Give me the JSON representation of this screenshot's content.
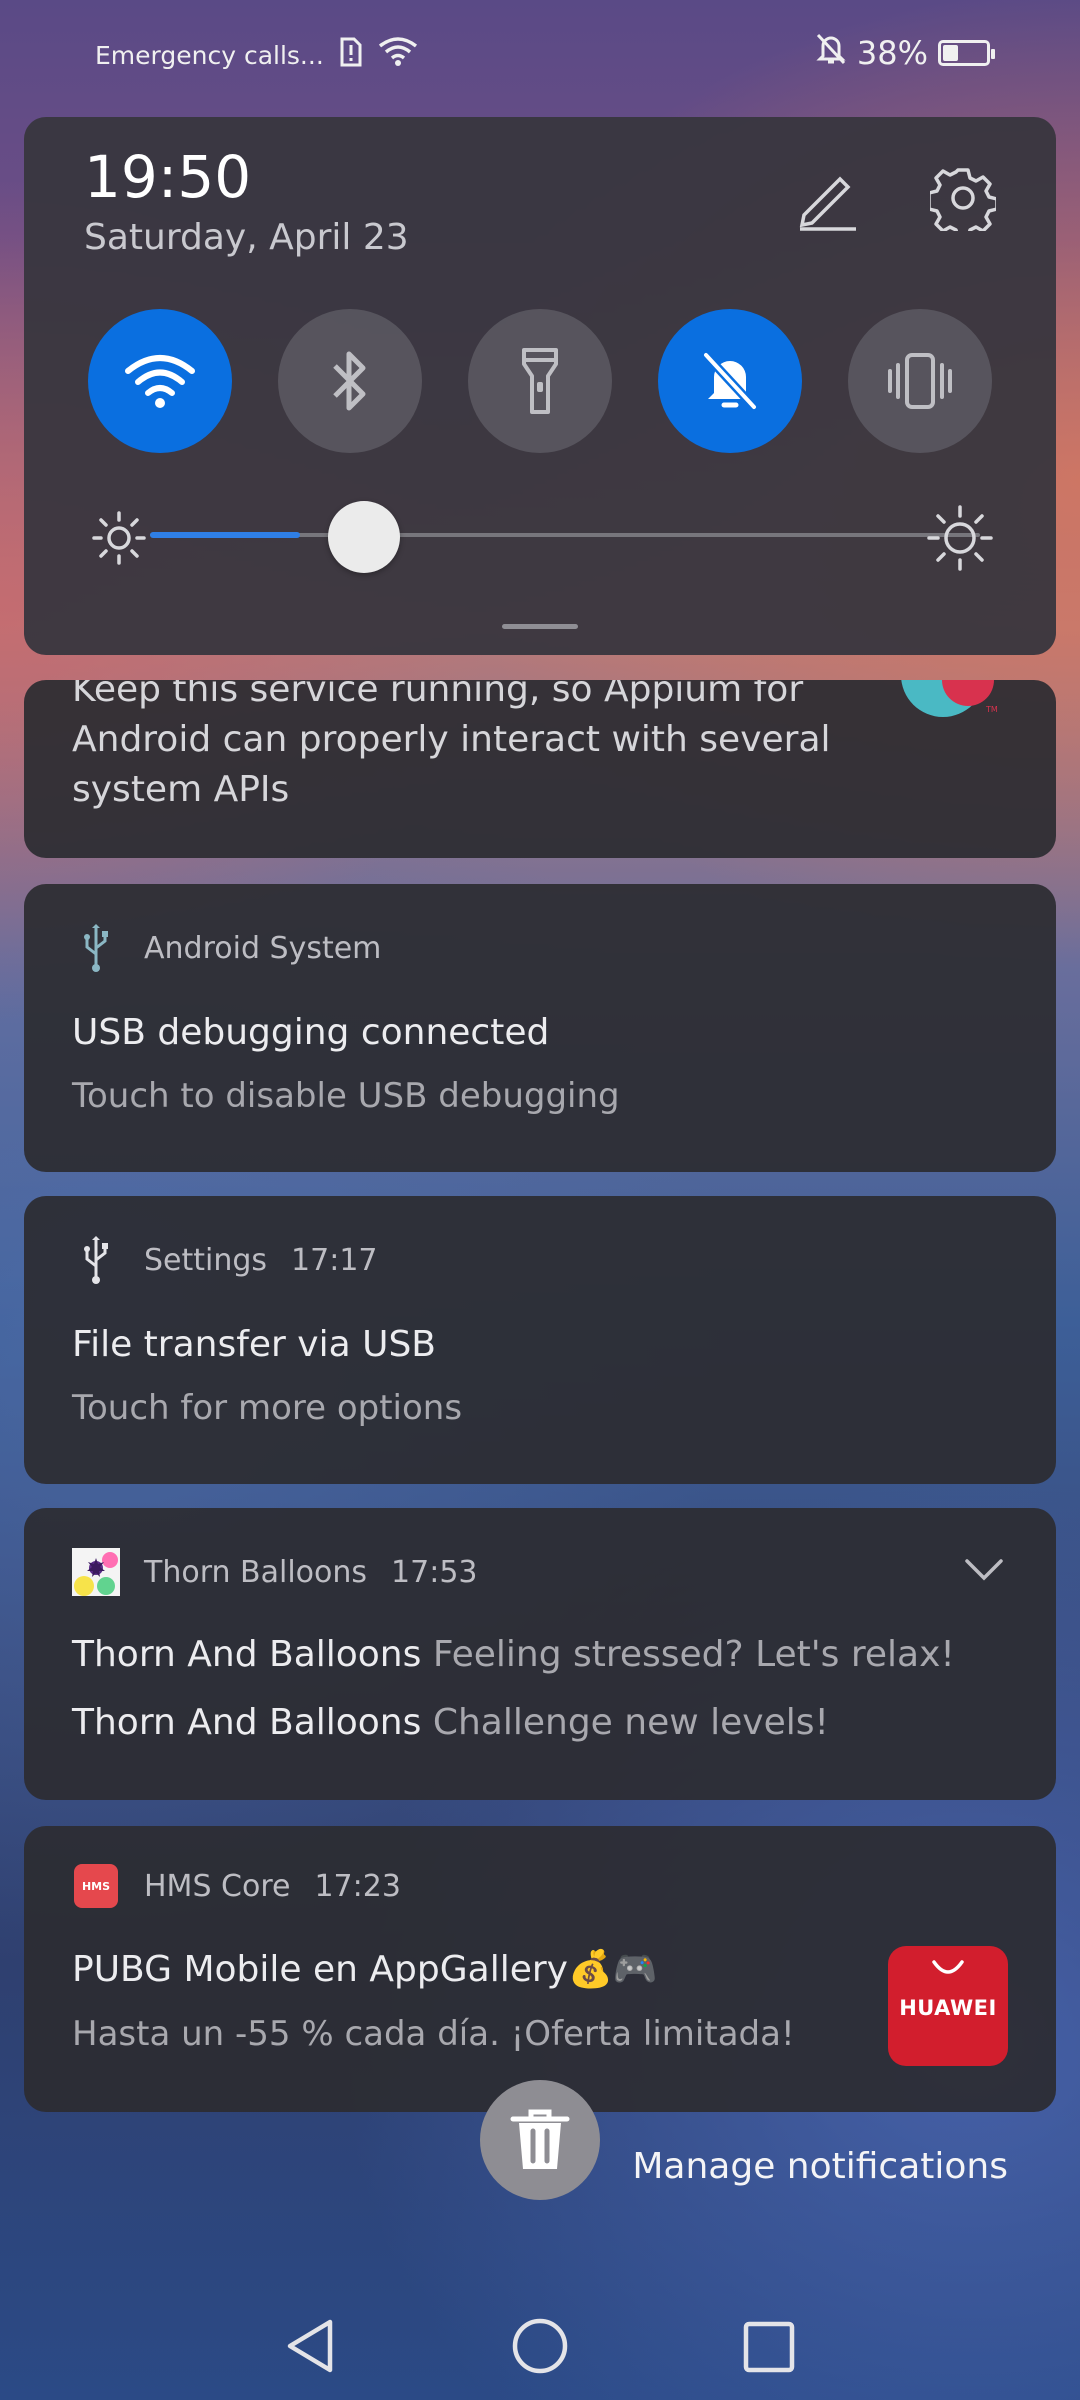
{
  "status_bar": {
    "carrier_text": "Emergency calls...",
    "battery": "38%",
    "battery_level": 0.38
  },
  "quick_settings": {
    "time": "19:50",
    "date": "Saturday, April 23",
    "tiles": [
      {
        "name": "wifi",
        "active": true
      },
      {
        "name": "bluetooth",
        "active": false
      },
      {
        "name": "flashlight",
        "active": false
      },
      {
        "name": "mute",
        "active": true
      },
      {
        "name": "vibrate",
        "active": false
      }
    ],
    "brightness_level": 0.2
  },
  "notifications": {
    "appium": {
      "text": "Keep this service running, so Appium for Android can properly interact with several system APIs",
      "line1": "Keep this service running, so Appium for",
      "line2": "Android can properly interact with several",
      "line3": "system APIs"
    },
    "android_system": {
      "app": "Android System",
      "title": "USB debugging connected",
      "subtitle": "Touch to disable USB debugging"
    },
    "settings": {
      "app": "Settings",
      "time": "17:17",
      "title": "File transfer via USB",
      "subtitle": "Touch for more options"
    },
    "thorn": {
      "app": "Thorn Balloons",
      "time": "17:53",
      "lines": [
        {
          "title": "Thorn And Balloons",
          "text": "Feeling stressed? Let's relax!"
        },
        {
          "title": "Thorn And Balloons",
          "text": "Challenge new levels!"
        }
      ]
    },
    "hms": {
      "app": "HMS Core",
      "icon_label": "HMS",
      "time": "17:23",
      "title": "PUBG Mobile en AppGallery💰🎮",
      "subtitle": "Hasta un -55 % cada día. ¡Oferta limitada!",
      "thumb_label": "HUAWEI"
    }
  },
  "actions": {
    "manage": "Manage notifications"
  },
  "colors": {
    "accent": "#0a6fe0",
    "huawei_red": "#d21e2d"
  }
}
